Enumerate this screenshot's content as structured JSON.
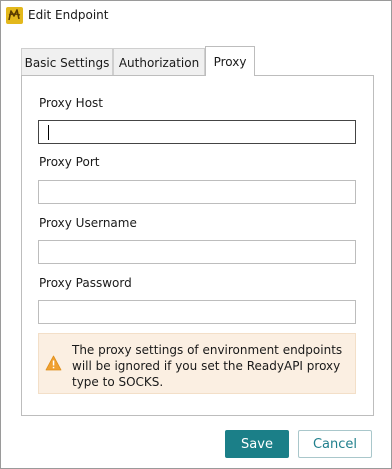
{
  "window": {
    "title": "Edit Endpoint",
    "icon": "readyapi-app-icon"
  },
  "tabs": [
    {
      "label": "Basic Settings",
      "active": false
    },
    {
      "label": "Authorization",
      "active": false
    },
    {
      "label": "Proxy",
      "active": true
    }
  ],
  "proxy": {
    "host": {
      "label": "Proxy Host",
      "value": ""
    },
    "port": {
      "label": "Proxy Port",
      "value": ""
    },
    "username": {
      "label": "Proxy Username",
      "value": ""
    },
    "password": {
      "label": "Proxy Password",
      "value": ""
    }
  },
  "warning": {
    "icon": "warning-icon",
    "text": "The proxy settings of environment endpoints will be ignored if you set the ReadyAPI proxy type to SOCKS."
  },
  "footer": {
    "save_label": "Save",
    "cancel_label": "Cancel"
  },
  "colors": {
    "accent": "#1b7f88",
    "warning_bg": "#fbefe2",
    "warning_icon": "#f0a030"
  }
}
